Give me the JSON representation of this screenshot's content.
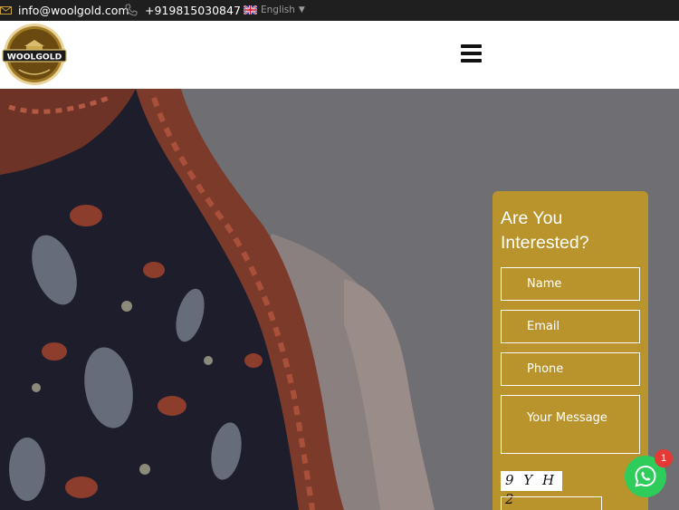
{
  "topbar": {
    "email": "info@woolgold.com",
    "phone": "+919815030847",
    "language": "English",
    "icons": [
      "envelope-icon",
      "phone-icon",
      "uk-flag-icon",
      "caret-down-icon"
    ]
  },
  "header": {
    "logo_text": "WOOLGOLD",
    "menu_icon": "hamburger-icon"
  },
  "form": {
    "title_line1": "Are You",
    "title_line2": "Interested?",
    "name_placeholder": "Name",
    "email_placeholder": "Email",
    "phone_placeholder": "Phone",
    "message_placeholder": "Your Message",
    "captcha_text": "9 Y H 2",
    "accent_color": "#b9942c"
  },
  "whatsapp": {
    "icon": "whatsapp-icon",
    "badge_count": "1",
    "color": "#2ecc5b"
  }
}
